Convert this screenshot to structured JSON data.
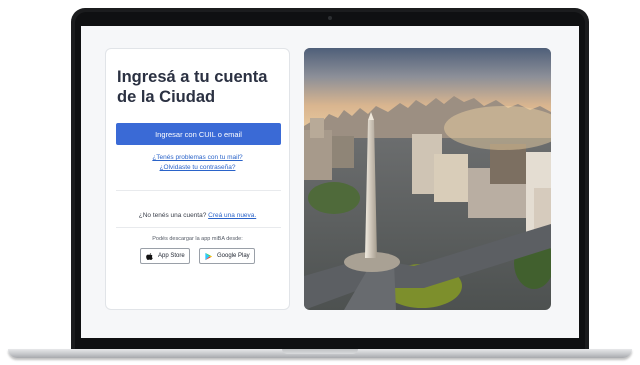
{
  "login": {
    "title": "Ingresá a tu cuenta de la Ciudad",
    "login_button": "Ingresar con CUIL o email",
    "mail_problems_link": "¿Tenés problemas con tu mail?",
    "forgot_password_link": "¿Olvidaste tu contraseña?",
    "no_account_text": "¿No tenés una cuenta?",
    "create_account_link": "Creá una nueva.",
    "download_text": "Podés descargar la app miBA desde:",
    "app_store_label": "App Store",
    "google_play_label": "Google Play"
  },
  "colors": {
    "primary_button": "#3a6ad6",
    "link": "#2a63c9",
    "title_text": "#2b3142"
  },
  "photo": {
    "subject": "Obelisco de Buenos Aires"
  }
}
